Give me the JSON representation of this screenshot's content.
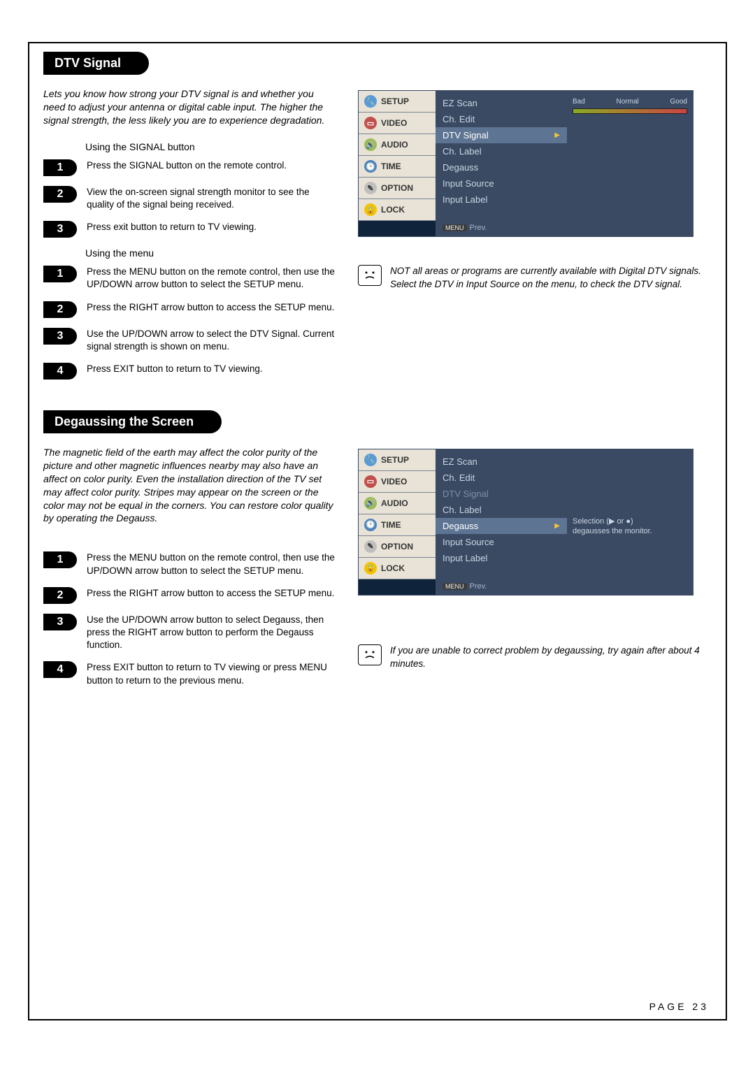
{
  "section1": {
    "title": "DTV Signal",
    "intro": "Lets you know how strong your DTV signal is and whether you need to adjust your antenna or digital cable input. The higher the signal strength, the less likely you are to experience degradation.",
    "sub1": "Using the SIGNAL button",
    "s1": "Press the SIGNAL button on the remote control.",
    "s2": "View the on-screen signal strength monitor to see the quality of the signal being received.",
    "s3": "Press exit button to return to TV viewing.",
    "sub2": "Using the menu",
    "m1": "Press the MENU button on the remote control, then use the UP/DOWN arrow button to select the SETUP menu.",
    "m2": "Press the RIGHT arrow button to access the SETUP menu.",
    "m3": "Use the UP/DOWN arrow to select the DTV Signal. Current signal strength is shown on menu.",
    "m4": "Press EXIT button to return to TV viewing.",
    "note": "NOT all areas or programs are currently available with Digital DTV signals. Select the DTV in Input Source on the menu, to check the DTV signal."
  },
  "osd": {
    "tabs": {
      "setup": "SETUP",
      "video": "VIDEO",
      "audio": "AUDIO",
      "time": "TIME",
      "option": "OPTION",
      "lock": "LOCK"
    },
    "items": {
      "ez": "EZ Scan",
      "ch": "Ch. Edit",
      "dtv": "DTV Signal",
      "lab": "Ch. Label",
      "deg": "Degauss",
      "src": "Input Source",
      "ilab": "Input Label"
    },
    "footer_badge": "MENU",
    "footer": "Prev.",
    "meter": {
      "bad": "Bad",
      "normal": "Normal",
      "good": "Good"
    },
    "degauss_hint1": "Selection (▶ or ●)",
    "degauss_hint2": "degausses the monitor."
  },
  "section2": {
    "title": "Degaussing the Screen",
    "intro": "The magnetic field of the earth may affect the color purity of the picture and other magnetic influences nearby may also have an affect on color purity. Even the installation direction of the TV set may affect color purity. Stripes may appear on the screen or the color may not be equal in the corners. You can restore color quality by operating the Degauss.",
    "s1": "Press the MENU button on the remote control, then use the UP/DOWN arrow button to select the SETUP menu.",
    "s2": "Press the RIGHT arrow button to access the SETUP menu.",
    "s3": "Use the UP/DOWN arrow button to select Degauss, then press the RIGHT arrow button to perform the Degauss function.",
    "s4": "Press EXIT button to return to TV viewing or press MENU button to return to the previous menu.",
    "note": "If you are unable to correct problem by degaussing, try again after about 4 minutes."
  },
  "pagenum": "PAGE 23"
}
